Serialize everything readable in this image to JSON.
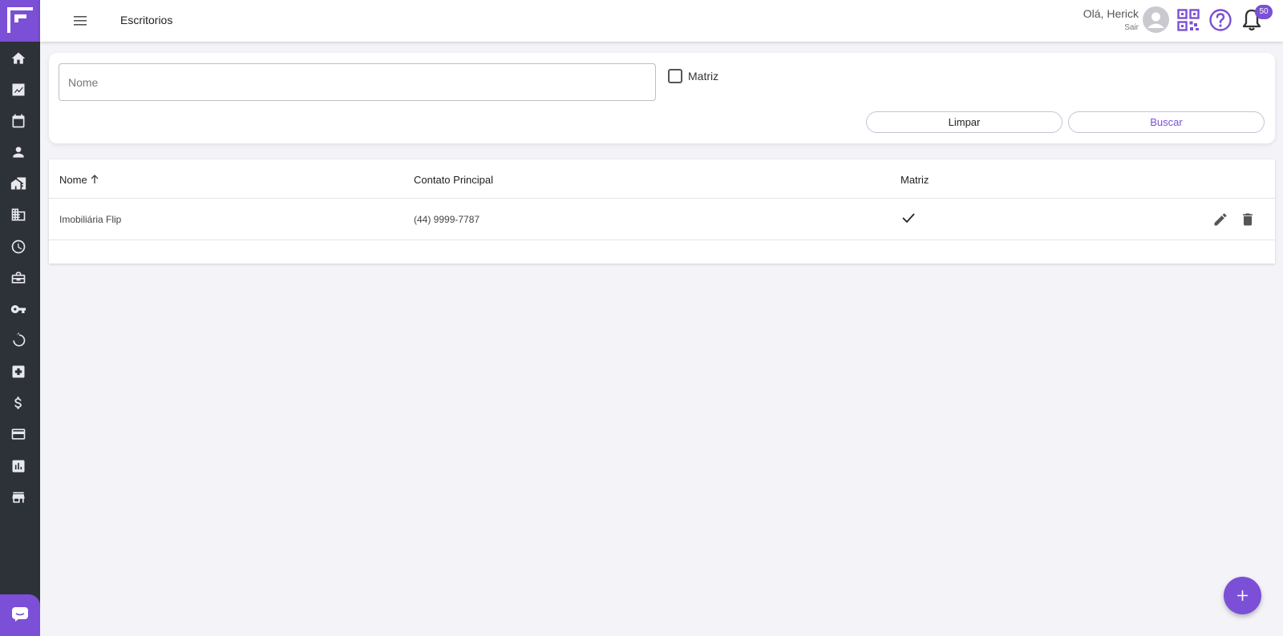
{
  "header": {
    "title": "Escritorios",
    "greeting": "Olá, Herick",
    "logout_label": "Sair",
    "notifications_count": "50"
  },
  "sidebar": {
    "items": [
      {
        "icon": "home-icon"
      },
      {
        "icon": "trending-chart-icon"
      },
      {
        "icon": "calendar-icon"
      },
      {
        "icon": "person-icon"
      },
      {
        "icon": "property-icon"
      },
      {
        "icon": "building-icon"
      },
      {
        "icon": "clock-icon"
      },
      {
        "icon": "briefcase-icon"
      },
      {
        "icon": "key-icon"
      },
      {
        "icon": "renew-icon"
      },
      {
        "icon": "medical-box-icon"
      },
      {
        "icon": "dollar-icon"
      },
      {
        "icon": "credit-card-icon"
      },
      {
        "icon": "bar-chart-icon"
      },
      {
        "icon": "store-icon"
      }
    ]
  },
  "filter": {
    "name_placeholder": "Nome",
    "name_value": "",
    "matriz_label": "Matriz",
    "matriz_checked": false,
    "clear_label": "Limpar",
    "search_label": "Buscar"
  },
  "table": {
    "columns": [
      "Nome",
      "Contato Principal",
      "Matriz"
    ],
    "rows": [
      {
        "nome": "Imobiliária Flip",
        "contato": "(44) 9999-7787",
        "matriz": true
      }
    ]
  },
  "colors": {
    "accent": "#7b4fd6",
    "sidebar": "#2c3237",
    "background": "#f3f3f8"
  }
}
